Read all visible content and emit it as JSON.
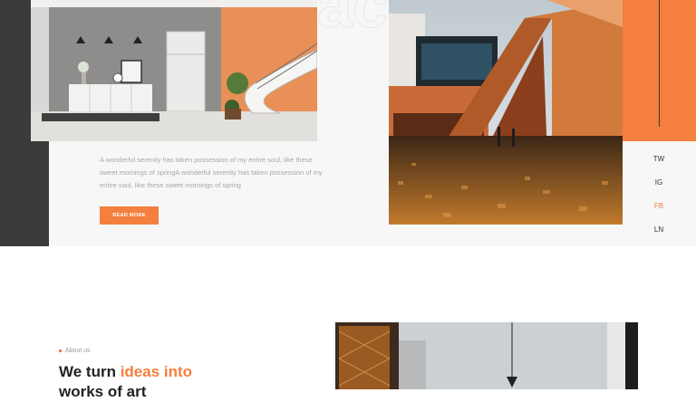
{
  "hero": {
    "ghost_text": "ac",
    "description": "A wonderful serenity has taken possession of my entire soul, like these sweet mornings of springA wonderful serenity has taken possession of my entire soul, like these sweet mornings of spring",
    "button_label": "READ MORE"
  },
  "social": [
    "TW",
    "IG",
    "FB",
    "LN"
  ],
  "about": {
    "label": "About us",
    "heading_start": "We turn ",
    "heading_accent": "ideas into",
    "heading_end": "works of art"
  },
  "colors": {
    "accent": "#f47f3e",
    "dark": "#3a3a3a"
  }
}
